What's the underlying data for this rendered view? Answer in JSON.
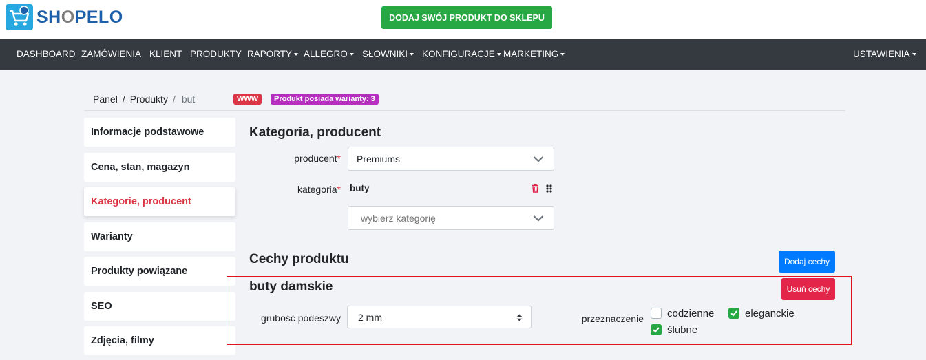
{
  "header": {
    "logo_text_1": "SH",
    "logo_text_2": "O",
    "logo_text_3": "PELO",
    "cta_label": "DODAJ SWÓJ PRODUKT DO SKLEPU",
    "colors": {
      "cta": "#28a745",
      "navbar": "#343a40",
      "logo_blue": "#1d5fa8",
      "logo_icon": "#27a8e0"
    }
  },
  "nav": {
    "items": [
      {
        "label": "DASHBOARD",
        "dropdown": false
      },
      {
        "label": "ZAMÓWIENIA",
        "dropdown": false
      },
      {
        "label": "KLIENT",
        "dropdown": false
      },
      {
        "label": "PRODUKTY",
        "dropdown": false
      },
      {
        "label": "RAPORTY",
        "dropdown": true
      },
      {
        "label": "ALLEGRO",
        "dropdown": true
      },
      {
        "label": "SŁOWNIKI",
        "dropdown": true
      },
      {
        "label": "KONFIGURACJE",
        "dropdown": true
      },
      {
        "label": "MARKETING",
        "dropdown": true
      }
    ],
    "settings": {
      "label": "USTAWIENIA",
      "dropdown": true
    }
  },
  "breadcrumb": {
    "items": [
      "Panel",
      "Produkty"
    ],
    "separator": "/",
    "current": "but"
  },
  "badges": [
    {
      "label": "WWW",
      "color": "#dc3545"
    },
    {
      "label": "Produkt posiada warianty: 3",
      "color": "#b62fbf"
    }
  ],
  "sidebar": {
    "items": [
      {
        "label": "Informacje podstawowe",
        "active": false
      },
      {
        "label": "Cena, stan, magazyn",
        "active": false
      },
      {
        "label": "Kategorie, producent",
        "active": true
      },
      {
        "label": "Warianty",
        "active": false
      },
      {
        "label": "Produkty powiązane",
        "active": false
      },
      {
        "label": "SEO",
        "active": false
      },
      {
        "label": "Zdjęcia, filmy",
        "active": false
      }
    ]
  },
  "main": {
    "section_title": "Kategoria, producent",
    "producer": {
      "label": "producent",
      "required_mark": "*",
      "value": "Premiums"
    },
    "category": {
      "label": "kategoria",
      "required_mark": "*",
      "value": "buty",
      "placeholder": "wybierz kategorię"
    },
    "features": {
      "title": "Cechy produktu",
      "add_button": "Dodaj cechy",
      "group_title": "buty damskie",
      "remove_button": "Usuń cechy",
      "sole": {
        "label": "grubość podeszwy",
        "value": "2 mm"
      },
      "purpose": {
        "label": "przeznaczenie",
        "options": [
          {
            "label": "codzienne",
            "checked": false
          },
          {
            "label": "eleganckie",
            "checked": true
          },
          {
            "label": "ślubne",
            "checked": true
          }
        ]
      }
    }
  }
}
